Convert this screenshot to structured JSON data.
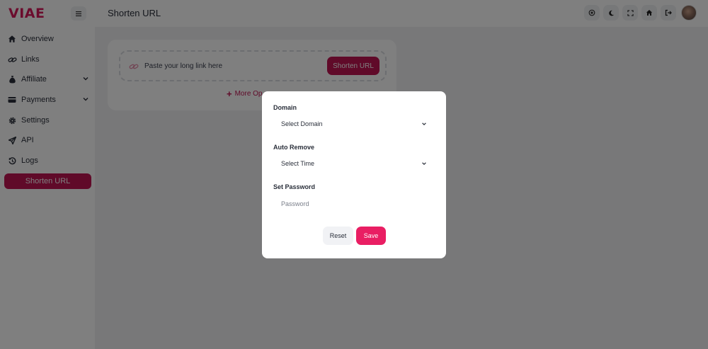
{
  "brand": {
    "logo_text": "VIAE",
    "accent": "#d6195b"
  },
  "header": {
    "title": "Shorten URL",
    "icons": [
      "theme-icon",
      "moon-icon",
      "fullscreen-icon",
      "home-icon",
      "logout-icon"
    ]
  },
  "sidebar": {
    "items": [
      {
        "label": "Overview",
        "icon": "home-icon"
      },
      {
        "label": "Links",
        "icon": "link-icon"
      },
      {
        "label": "Affiliate",
        "icon": "money-bag-icon",
        "has_submenu": true
      },
      {
        "label": "Payments",
        "icon": "card-icon",
        "has_submenu": true
      },
      {
        "label": "Settings",
        "icon": "gear-icon"
      },
      {
        "label": "API",
        "icon": "send-icon"
      },
      {
        "label": "Logs",
        "icon": "history-icon"
      }
    ],
    "active_label": "Shorten URL"
  },
  "main": {
    "url_placeholder": "Paste your long link here",
    "shorten_button": "Shorten URL",
    "more_options": "More Op"
  },
  "modal": {
    "domain_label": "Domain",
    "domain_value": "Select Domain",
    "auto_remove_label": "Auto Remove",
    "auto_remove_value": "Select Time",
    "password_label": "Set Password",
    "password_placeholder": "Password",
    "reset_button": "Reset",
    "save_button": "Save"
  }
}
